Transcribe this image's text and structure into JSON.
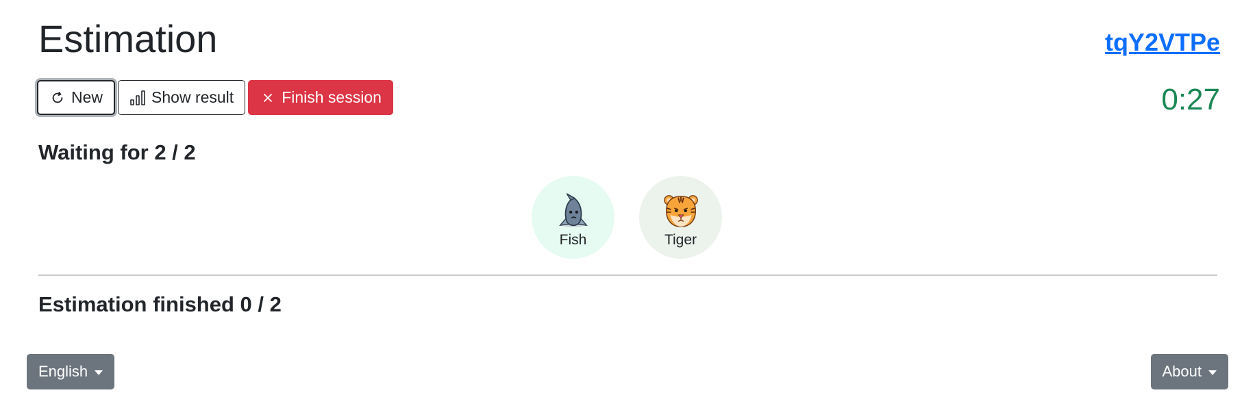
{
  "header": {
    "title": "Estimation",
    "session_code": "tqY2VTPe"
  },
  "toolbar": {
    "new_label": "New",
    "show_result_label": "Show result",
    "finish_label": "Finish session"
  },
  "timer": {
    "value": "0:27",
    "color": "#198754"
  },
  "waiting": {
    "label": "Waiting for 2 / 2",
    "participants": [
      {
        "name": "Fish",
        "icon": "fish-icon",
        "bg_color": "#e6fbf1"
      },
      {
        "name": "Tiger",
        "icon": "tiger-icon",
        "bg_color": "#ecf3ec"
      }
    ]
  },
  "finished": {
    "label": "Estimation finished 0 / 2"
  },
  "footer": {
    "language_label": "English",
    "about_label": "About"
  },
  "colors": {
    "link": "#0d6efd",
    "danger": "#dc3545",
    "secondary": "#6c757d"
  }
}
